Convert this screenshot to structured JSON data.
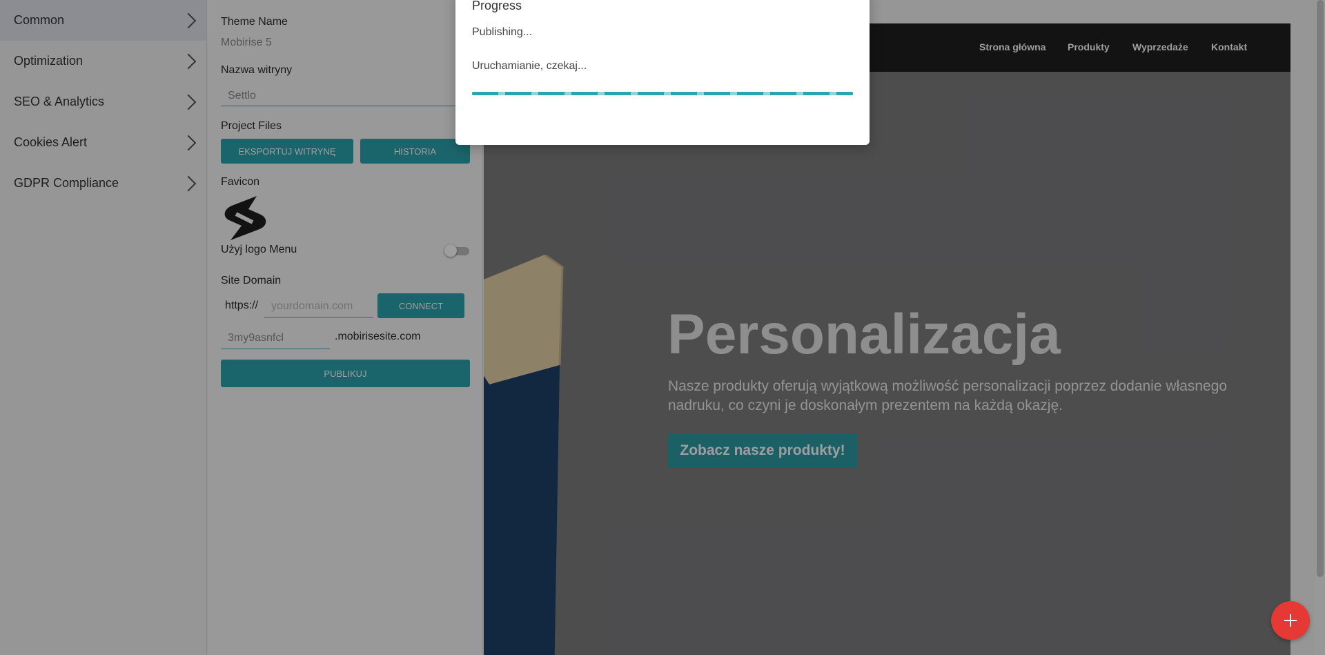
{
  "left_menu": {
    "items": [
      {
        "label": "Common",
        "active": true
      },
      {
        "label": "Optimization"
      },
      {
        "label": "SEO & Analytics"
      },
      {
        "label": "Cookies Alert"
      },
      {
        "label": "GDPR Compliance"
      }
    ]
  },
  "settings": {
    "theme_name_label": "Theme Name",
    "theme_name_value": "Mobirise 5",
    "site_name_label": "Nazwa witryny",
    "site_name_value": "Settlo",
    "project_files_label": "Project Files",
    "export_button": "EKSPORTUJ WITRYNĘ",
    "history_button": "HISTORIA",
    "favicon_label": "Favicon",
    "use_logo_label": "Użyj logo Menu",
    "use_logo_on": false,
    "site_domain_label": "Site Domain",
    "protocol": "https://",
    "domain_placeholder": "yourdomain.com",
    "connect_button": "CONNECT",
    "subdomain_value": "3my9asnfcl",
    "subdomain_suffix": ".mobirisesite.com",
    "publish_button": "PUBLIKUJ"
  },
  "site": {
    "nav": [
      "Strona główna",
      "Produkty",
      "Wyprzedaże",
      "Kontakt"
    ],
    "hero_title": "Personalizacja",
    "hero_text": "Nasze produkty oferują wyjątkową możliwość personalizacji poprzez dodanie własnego nadruku, co czyni je doskonałym prezentem na każdą okazję.",
    "hero_button": "Zobacz nasze produkty!"
  },
  "dialog": {
    "title": "Progress",
    "status": "Publishing...",
    "message": "Uruchamianie, czekaj..."
  },
  "colors": {
    "accent": "#2aa4ad",
    "fab": "#e53935"
  },
  "icons": [
    "chevron-right-icon",
    "favicon-logo",
    "plus-icon"
  ]
}
